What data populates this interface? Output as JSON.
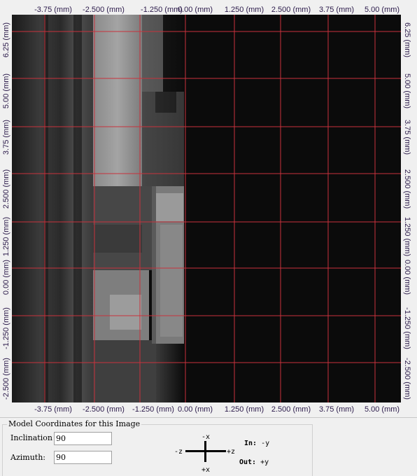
{
  "viewer": {
    "x_ticks": [
      "-3.75 (mm)",
      "-2.500 (mm)",
      "-1.250 (mm)",
      "0.00 (mm)",
      "1.250 (mm)",
      "2.500 (mm)",
      "3.75 (mm)",
      "5.00 (mm)"
    ],
    "y_ticks": [
      "6.25 (mm)",
      "5.00 (mm)",
      "3.75 (mm)",
      "2.500 (mm)",
      "1.250 (mm)",
      "0.00 (mm)",
      "-1.250 (mm)",
      "-2.500 (mm)"
    ],
    "grid_color": "#c8323c",
    "image_background": "#0b0b0b"
  },
  "panel": {
    "group_title": "Model Coordinates for this Image",
    "inclination_label": "Inclination",
    "inclination_value": "90",
    "azimuth_label": "Azimuth:",
    "azimuth_value": "90",
    "directions": {
      "up": "-x",
      "down": "+x",
      "left": "-z",
      "right": "+z"
    },
    "in_label": "In:",
    "in_value": "-y",
    "out_label": "Out:",
    "out_value": "+y"
  }
}
